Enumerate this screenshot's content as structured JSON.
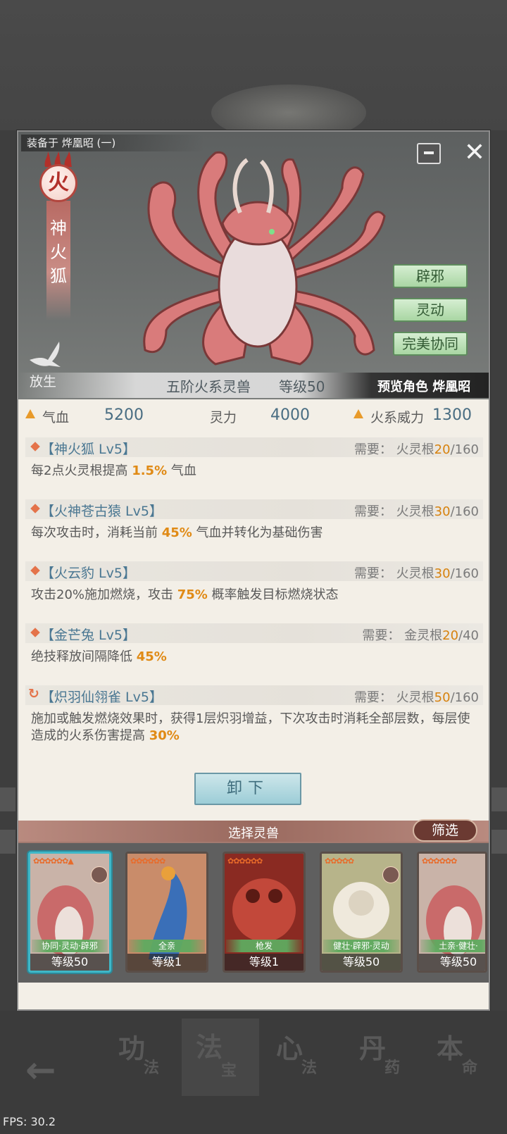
{
  "panel": {
    "equip_title": "装备于 烨凰昭 (一)",
    "element_char": "火",
    "beast_name": "神火狐",
    "release_label": "放生",
    "traits": [
      "辟邪",
      "灵动",
      "完美协同"
    ],
    "tier": "五阶火系灵兽",
    "level": "等级50",
    "preview": "预览角色 烨凰昭"
  },
  "stats": {
    "hp_label": "气血",
    "hp_value": "5200",
    "spirit_label": "灵力",
    "spirit_value": "4000",
    "fire_label": "火系威力",
    "fire_value": "1300"
  },
  "skills": [
    {
      "name": "【神火狐 Lv5】",
      "req_prefix": "需要：  火灵根",
      "req_have": "20",
      "req_total": "/160",
      "desc_a": "每2点火灵根提高 ",
      "desc_hl": "1.5%",
      "desc_b": " 气血"
    },
    {
      "name": "【火神苍古猿 Lv5】",
      "req_prefix": "需要：  火灵根",
      "req_have": "30",
      "req_total": "/160",
      "desc_a": "每次攻击时，消耗当前 ",
      "desc_hl": "45%",
      "desc_b": " 气血并转化为基础伤害"
    },
    {
      "name": "【火云豹 Lv5】",
      "req_prefix": "需要：  火灵根",
      "req_have": "30",
      "req_total": "/160",
      "desc_a": "攻击20%施加燃烧，攻击 ",
      "desc_hl": "75%",
      "desc_b": " 概率触发目标燃烧状态"
    },
    {
      "name": "【金芒兔 Lv5】",
      "req_prefix": "需要：  金灵根",
      "req_have": "20",
      "req_total": "/40",
      "desc_a": "绝技释放间隔降低 ",
      "desc_hl": "45%",
      "desc_b": ""
    },
    {
      "name": "【炽羽仙翎雀 Lv5】",
      "req_prefix": "需要：  火灵根",
      "req_have": "50",
      "req_total": "/160",
      "desc_a": "施加或触发燃烧效果时，获得1层炽羽增益，下次攻击时消耗全部层数，每层使造成的火系伤害提高 ",
      "desc_hl": "30%",
      "desc_b": ""
    }
  ],
  "unload_label": "卸下",
  "select_title": "选择灵兽",
  "filter_label": "筛选",
  "cards": [
    {
      "traits": "协同·灵动·辟邪",
      "level": "等级50",
      "stars": "✿✿✿✿✿✿▲"
    },
    {
      "traits": "全亲",
      "level": "等级1",
      "stars": "✿✿✿✿✿✿"
    },
    {
      "traits": "枪发",
      "level": "等级1",
      "stars": "✿✿✿✿✿✿"
    },
    {
      "traits": "健壮·辟邪·灵动",
      "level": "等级50",
      "stars": "✿✿✿✿✿"
    },
    {
      "traits": "土亲·健壮·",
      "level": "等级50",
      "stars": "✿✿✿✿✿✿"
    }
  ],
  "nav": [
    {
      "big": "功",
      "small": "法"
    },
    {
      "big": "法",
      "small": "宝"
    },
    {
      "big": "心",
      "small": "法"
    },
    {
      "big": "丹",
      "small": "药"
    },
    {
      "big": "本",
      "small": "命"
    }
  ],
  "fps": "FPS: 30.2",
  "colors": {
    "accent_orange": "#e08a15",
    "skill_blue": "#4a7792",
    "trait_green": "#a9d6a3"
  }
}
